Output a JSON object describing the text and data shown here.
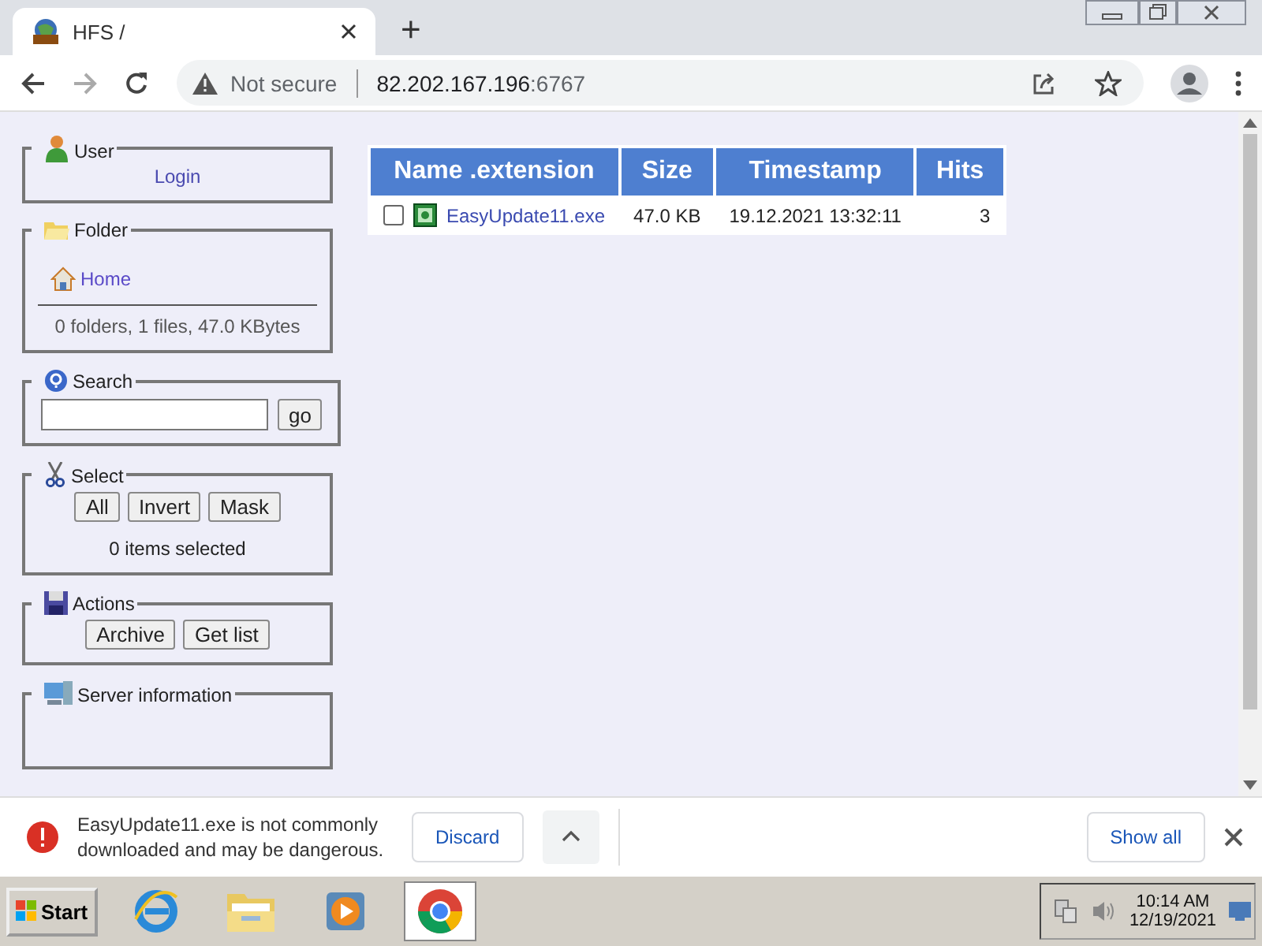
{
  "browser": {
    "tab": {
      "title": "HFS /"
    },
    "new_tab": "+",
    "address": {
      "security": "Not secure",
      "host": "82.202.167.196",
      "port": ":6767"
    }
  },
  "sidebar": [
    {
      "kind": "user",
      "legend": "User",
      "link": "Login"
    },
    {
      "kind": "folder",
      "legend": "Folder",
      "link": "Home",
      "info": "0 folders, 1 files, 47.0 KBytes"
    },
    {
      "kind": "search",
      "legend": "Search",
      "button": "go"
    },
    {
      "kind": "select",
      "legend": "Select",
      "buttons": [
        "All",
        "Invert",
        "Mask"
      ],
      "info": "0 items selected"
    },
    {
      "kind": "actions",
      "legend": "Actions",
      "buttons": [
        "Archive",
        "Get list"
      ]
    },
    {
      "kind": "server",
      "legend": "Server information"
    }
  ],
  "table": {
    "columns": [
      "Name .extension",
      "Size",
      "Timestamp",
      "Hits"
    ],
    "rows": [
      {
        "checked": false,
        "name": "EasyUpdate11.exe",
        "size": "47.0 KB",
        "timestamp": "19.12.2021 13:32:11",
        "hits": "3"
      }
    ]
  },
  "download_bar": {
    "message": "EasyUpdate11.exe is not commonly downloaded and may be dangerous.",
    "discard": "Discard",
    "show_all": "Show all"
  },
  "taskbar": {
    "start": "Start",
    "apps": [
      {
        "kind": "ie",
        "selected": false
      },
      {
        "kind": "explorer",
        "selected": false
      },
      {
        "kind": "media",
        "selected": false
      },
      {
        "kind": "chrome",
        "selected": true
      }
    ],
    "time": "10:14 AM",
    "date": "12/19/2021"
  }
}
